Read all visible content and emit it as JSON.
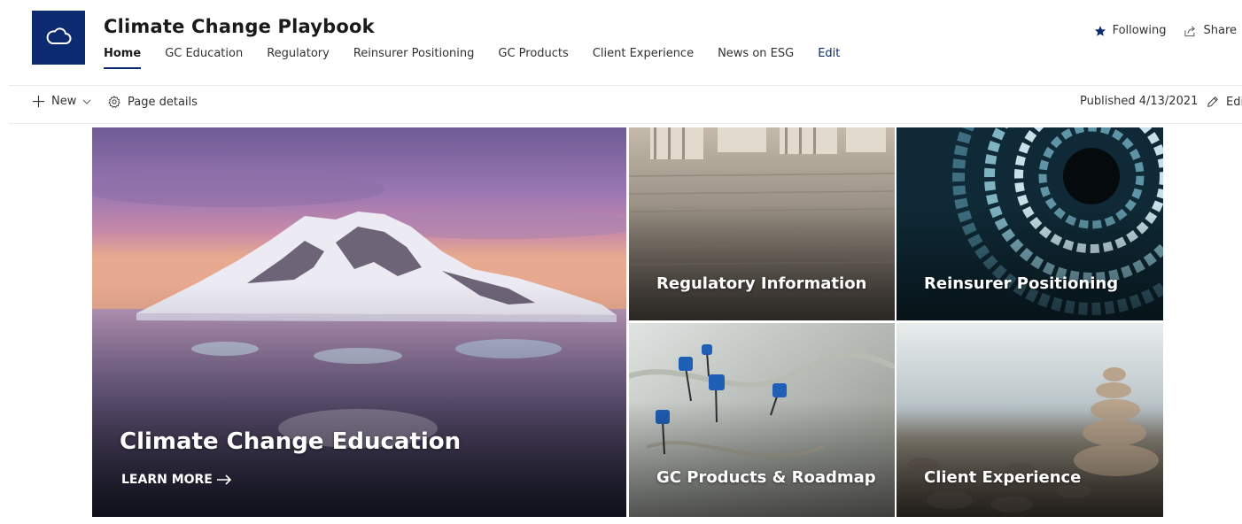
{
  "site": {
    "title": "Climate Change Playbook",
    "logo_icon": "cloud-icon",
    "brand_color": "#0b2a6f"
  },
  "nav": {
    "items": [
      {
        "label": "Home",
        "active": true
      },
      {
        "label": "GC Education"
      },
      {
        "label": "Regulatory"
      },
      {
        "label": "Reinsurer Positioning"
      },
      {
        "label": "GC Products"
      },
      {
        "label": "Client Experience"
      },
      {
        "label": "News on ESG"
      },
      {
        "label": "Edit"
      }
    ]
  },
  "header_actions": {
    "following_label": "Following",
    "following_icon": "star-icon",
    "share_label": "Share",
    "share_icon": "share-icon"
  },
  "command_bar": {
    "new_label": "New",
    "page_details_label": "Page details",
    "published_label": "Published 4/13/2021",
    "edit_label": "Edi"
  },
  "hero": {
    "main": {
      "title": "Climate Change Education",
      "link_label": "LEARN MORE"
    },
    "tiles": [
      {
        "title": "Regulatory Information",
        "image": "courthouse-columns"
      },
      {
        "title": "Reinsurer Positioning",
        "image": "abstract-tunnel"
      },
      {
        "title": "GC Products & Roadmap",
        "image": "map-pins"
      },
      {
        "title": "Client Experience",
        "image": "stacked-stones"
      }
    ]
  }
}
